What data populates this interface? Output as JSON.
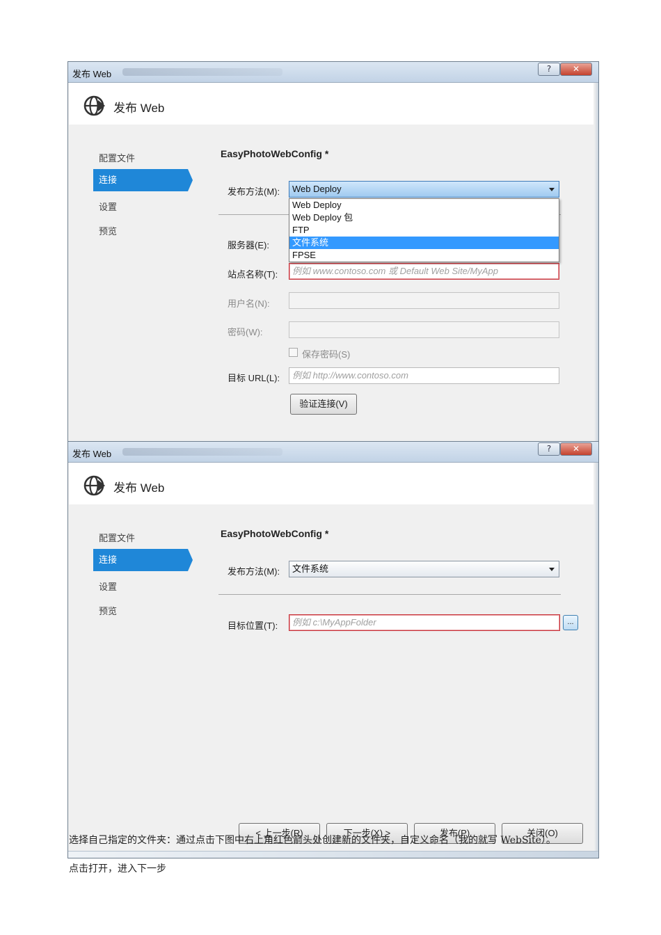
{
  "dialog1": {
    "title": "发布 Web",
    "help_glyph": "?",
    "close_glyph": "✕",
    "header_title": "发布 Web",
    "nav": [
      "配置文件",
      "连接",
      "设置",
      "预览"
    ],
    "profile": "EasyPhotoWebConfig *",
    "method_label": "发布方法(M):",
    "method_value": "Web Deploy",
    "dropdown_options": [
      "Web Deploy",
      "Web Deploy 包",
      "FTP",
      "文件系统",
      "FPSE"
    ],
    "dropdown_selected": "文件系统",
    "server_label": "服务器(E):",
    "site_label": "站点名称(T):",
    "site_placeholder": "例如 www.contoso.com 或 Default Web Site/MyApp",
    "user_label": "用户名(N):",
    "password_label": "密码(W):",
    "save_password_label": "保存密码(S)",
    "target_url_label": "目标 URL(L):",
    "target_url_placeholder": "例如 http://www.contoso.com",
    "validate_button": "验证连接(V)"
  },
  "dialog2": {
    "title": "发布 Web",
    "help_glyph": "?",
    "close_glyph": "✕",
    "header_title": "发布 Web",
    "nav": [
      "配置文件",
      "连接",
      "设置",
      "预览"
    ],
    "profile": "EasyPhotoWebConfig *",
    "method_label": "发布方法(M):",
    "method_value": "文件系统",
    "target_location_label": "目标位置(T):",
    "target_location_placeholder": "例如 c:\\MyAppFolder",
    "browse_button": "...",
    "buttons": {
      "prev": "< 上一步(R)",
      "next": "下一步(X) >",
      "publish": "发布(P)",
      "close": "关闭(O)"
    }
  },
  "captions": [
    "选择自己指定的文件夹：通过点击下图中右上角红色箭头处创建新的文件夹，自定义命名（我的就写 WebSite）。",
    "点击打开，进入下一步"
  ],
  "colors": {
    "nav_active": "#1f87d8",
    "dropdown_selected": "#3399ff",
    "error_border": "#c8323a"
  }
}
